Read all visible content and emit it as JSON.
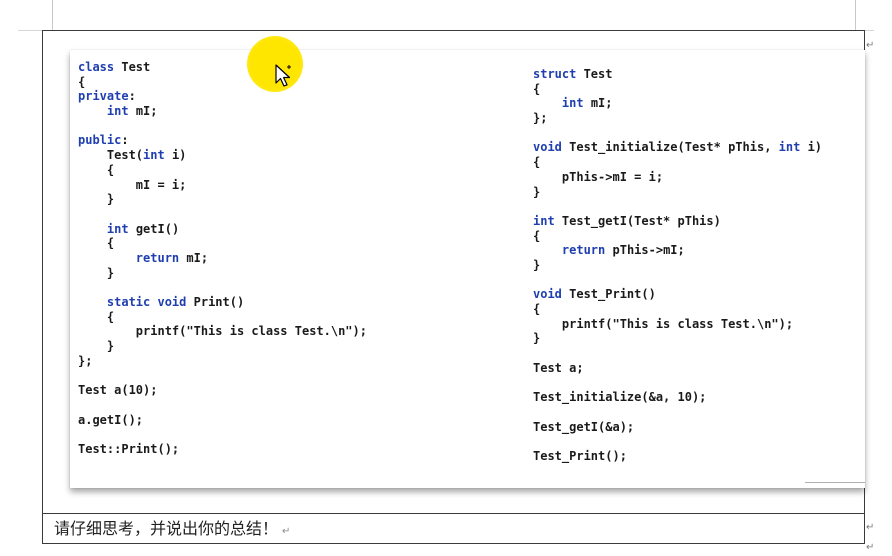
{
  "left_code": [
    [
      {
        "t": "class",
        "k": 1
      },
      {
        "t": " Test"
      }
    ],
    [
      {
        "t": "{"
      }
    ],
    [
      {
        "t": "private",
        "k": 1
      },
      {
        "t": ":"
      }
    ],
    [
      {
        "t": "    "
      },
      {
        "t": "int",
        "k": 1
      },
      {
        "t": " mI;"
      }
    ],
    [
      {
        "t": ""
      }
    ],
    [
      {
        "t": "public",
        "k": 1
      },
      {
        "t": ":"
      }
    ],
    [
      {
        "t": "    Test("
      },
      {
        "t": "int",
        "k": 1
      },
      {
        "t": " i)"
      }
    ],
    [
      {
        "t": "    {"
      }
    ],
    [
      {
        "t": "        mI = i;"
      }
    ],
    [
      {
        "t": "    }"
      }
    ],
    [
      {
        "t": ""
      }
    ],
    [
      {
        "t": "    "
      },
      {
        "t": "int",
        "k": 1
      },
      {
        "t": " getI()"
      }
    ],
    [
      {
        "t": "    {"
      }
    ],
    [
      {
        "t": "        "
      },
      {
        "t": "return",
        "k": 1
      },
      {
        "t": " mI;"
      }
    ],
    [
      {
        "t": "    }"
      }
    ],
    [
      {
        "t": ""
      }
    ],
    [
      {
        "t": "    "
      },
      {
        "t": "static void",
        "k": 1
      },
      {
        "t": " Print()"
      }
    ],
    [
      {
        "t": "    {"
      }
    ],
    [
      {
        "t": "        printf(\"This is class Test.\\n\");"
      }
    ],
    [
      {
        "t": "    }"
      }
    ],
    [
      {
        "t": "};"
      }
    ],
    [
      {
        "t": ""
      }
    ],
    [
      {
        "t": "Test a(10);"
      }
    ],
    [
      {
        "t": ""
      }
    ],
    [
      {
        "t": "a.getI();"
      }
    ],
    [
      {
        "t": ""
      }
    ],
    [
      {
        "t": "Test::Print();"
      }
    ]
  ],
  "right_code": [
    [
      {
        "t": "struct",
        "k": 1
      },
      {
        "t": " Test"
      }
    ],
    [
      {
        "t": "{"
      }
    ],
    [
      {
        "t": "    "
      },
      {
        "t": "int",
        "k": 1
      },
      {
        "t": " mI;"
      }
    ],
    [
      {
        "t": "};"
      }
    ],
    [
      {
        "t": ""
      }
    ],
    [
      {
        "t": "void",
        "k": 1
      },
      {
        "t": " Test_initialize(Test* pThis, "
      },
      {
        "t": "int",
        "k": 1
      },
      {
        "t": " i)"
      }
    ],
    [
      {
        "t": "{"
      }
    ],
    [
      {
        "t": "    pThis->mI = i;"
      }
    ],
    [
      {
        "t": "}"
      }
    ],
    [
      {
        "t": ""
      }
    ],
    [
      {
        "t": "int",
        "k": 1
      },
      {
        "t": " Test_getI(Test* pThis)"
      }
    ],
    [
      {
        "t": "{"
      }
    ],
    [
      {
        "t": "    "
      },
      {
        "t": "return",
        "k": 1
      },
      {
        "t": " pThis->mI;"
      }
    ],
    [
      {
        "t": "}"
      }
    ],
    [
      {
        "t": ""
      }
    ],
    [
      {
        "t": "void",
        "k": 1
      },
      {
        "t": " Test_Print()"
      }
    ],
    [
      {
        "t": "{"
      }
    ],
    [
      {
        "t": "    printf(\"This is class Test.\\n\");"
      }
    ],
    [
      {
        "t": "}"
      }
    ],
    [
      {
        "t": ""
      }
    ],
    [
      {
        "t": "Test a;"
      }
    ],
    [
      {
        "t": ""
      }
    ],
    [
      {
        "t": "Test_initialize(&a, 10);"
      }
    ],
    [
      {
        "t": ""
      }
    ],
    [
      {
        "t": "Test_getI(&a);"
      }
    ],
    [
      {
        "t": ""
      }
    ],
    [
      {
        "t": "Test_Print();"
      }
    ]
  ],
  "colors": {
    "keyword": "#1f3fb0",
    "text": "#1a1a1a",
    "highlight": "#ffe600"
  },
  "caption": {
    "text": "请仔细思考，并说出你的总结！",
    "para_mark": "↵"
  },
  "para_marks": {
    "top": "↵",
    "middle": "↵",
    "bottom": "↵"
  },
  "icons": {
    "cursor": "pointer-arrow-icon",
    "highlight": "cursor-highlight-circle"
  }
}
